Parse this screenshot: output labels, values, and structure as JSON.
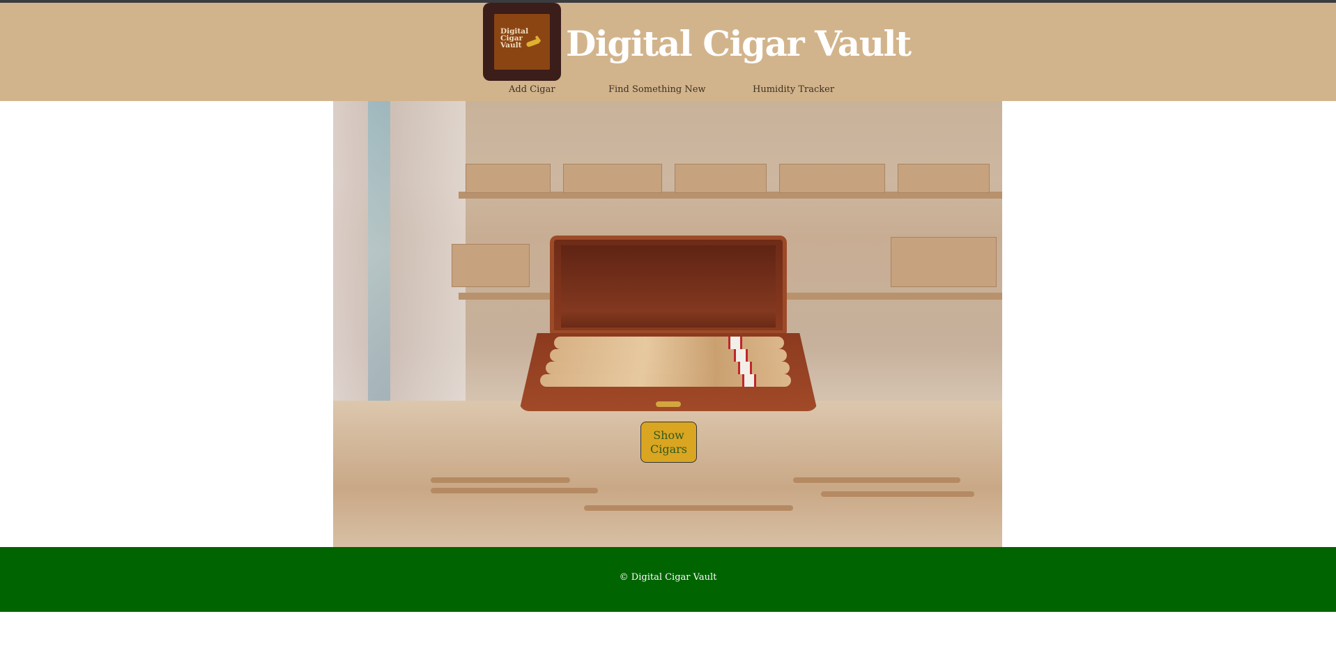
{
  "header": {
    "logo_text": "Digital Cigar Vault",
    "title": "Digital Cigar Vault",
    "nav": [
      "Add Cigar",
      "Find Something New",
      "Humidity Tracker"
    ]
  },
  "main": {
    "hero_image": "cigar-shop-photo",
    "case_image": "open-cigar-case-with-cigars",
    "show_button_label": "Show Cigars"
  },
  "footer": {
    "copyright": "© Digital Cigar Vault"
  },
  "colors": {
    "header_bg": "#d2b48c",
    "footer_bg": "#006400",
    "button_bg": "#daa520",
    "logo_bg": "#3b1d1a"
  }
}
